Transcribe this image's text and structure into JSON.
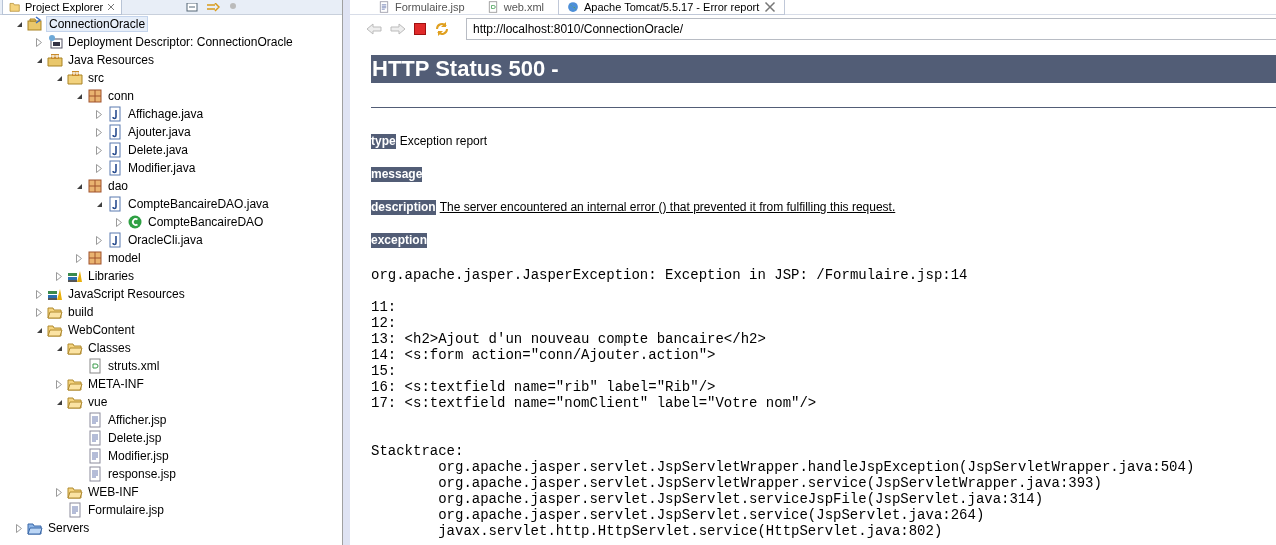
{
  "project_explorer": {
    "title": "Project Explorer",
    "tree": [
      {
        "label": "ConnectionOracle",
        "kind": "project",
        "expanded": true,
        "selected": true,
        "children": [
          {
            "label": "Deployment Descriptor: ConnectionOracle",
            "kind": "descriptor",
            "expanded": false,
            "selected": false
          },
          {
            "label": "Java Resources",
            "kind": "java-resources",
            "expanded": true,
            "selected": false,
            "children": [
              {
                "label": "src",
                "kind": "source-folder",
                "expanded": true,
                "selected": false,
                "children": [
                  {
                    "label": "conn",
                    "kind": "package",
                    "expanded": true,
                    "selected": false,
                    "children": [
                      {
                        "label": "Affichage.java",
                        "kind": "java-file",
                        "expanded": false,
                        "selected": false
                      },
                      {
                        "label": "Ajouter.java",
                        "kind": "java-file",
                        "expanded": false,
                        "selected": false
                      },
                      {
                        "label": "Delete.java",
                        "kind": "java-file",
                        "expanded": false,
                        "selected": false
                      },
                      {
                        "label": "Modifier.java",
                        "kind": "java-file",
                        "expanded": false,
                        "selected": false
                      }
                    ]
                  },
                  {
                    "label": "dao",
                    "kind": "package",
                    "expanded": true,
                    "selected": false,
                    "children": [
                      {
                        "label": "CompteBancaireDAO.java",
                        "kind": "java-file",
                        "expanded": true,
                        "selected": false,
                        "children": [
                          {
                            "label": "CompteBancaireDAO",
                            "kind": "class",
                            "expanded": false,
                            "selected": false
                          }
                        ]
                      },
                      {
                        "label": "OracleCli.java",
                        "kind": "java-file",
                        "expanded": false,
                        "selected": false
                      }
                    ]
                  },
                  {
                    "label": "model",
                    "kind": "package",
                    "expanded": false,
                    "selected": false
                  }
                ]
              },
              {
                "label": "Libraries",
                "kind": "library",
                "expanded": false,
                "selected": false
              }
            ]
          },
          {
            "label": "JavaScript Resources",
            "kind": "library",
            "expanded": false,
            "selected": false
          },
          {
            "label": "build",
            "kind": "folder",
            "expanded": false,
            "selected": false
          },
          {
            "label": "WebContent",
            "kind": "folder",
            "expanded": true,
            "selected": false,
            "children": [
              {
                "label": "Classes",
                "kind": "folder",
                "expanded": true,
                "selected": false,
                "children": [
                  {
                    "label": "struts.xml",
                    "kind": "xml-file",
                    "selected": false
                  }
                ]
              },
              {
                "label": "META-INF",
                "kind": "folder",
                "expanded": false,
                "selected": false
              },
              {
                "label": "vue",
                "kind": "folder",
                "expanded": true,
                "selected": false,
                "children": [
                  {
                    "label": "Afficher.jsp",
                    "kind": "jsp-file",
                    "selected": false
                  },
                  {
                    "label": "Delete.jsp",
                    "kind": "jsp-file",
                    "selected": false
                  },
                  {
                    "label": "Modifier.jsp",
                    "kind": "jsp-file",
                    "selected": false
                  },
                  {
                    "label": "response.jsp",
                    "kind": "jsp-file",
                    "selected": false
                  }
                ]
              },
              {
                "label": "WEB-INF",
                "kind": "folder",
                "expanded": false,
                "selected": false
              },
              {
                "label": "Formulaire.jsp",
                "kind": "jsp-file",
                "selected": false
              }
            ]
          }
        ]
      },
      {
        "label": "Servers",
        "kind": "servers-folder",
        "expanded": false,
        "selected": false
      }
    ]
  },
  "editor_tabs": [
    {
      "label": "Formulaire.jsp",
      "kind": "jsp-file",
      "selected": false
    },
    {
      "label": "web.xml",
      "kind": "xml-file",
      "selected": false
    },
    {
      "label": "Apache Tomcat/5.5.17 - Error report",
      "kind": "browser",
      "selected": true
    }
  ],
  "browser": {
    "url": "http://localhost:8010/ConnectionOracle/",
    "heading": "HTTP Status 500 -",
    "fields": [
      {
        "label": "type",
        "text": "Exception report",
        "underlined": false
      },
      {
        "label": "message"
      },
      {
        "label": "description",
        "text": "The server encountered an internal error () that prevented it from fulfilling this request.",
        "underlined": true
      },
      {
        "label": "exception"
      }
    ],
    "exception_line": "org.apache.jasper.JasperException: Exception in JSP: /Formulaire.jsp:14",
    "source_lines": [
      "11:",
      "12:",
      "13: <h2>Ajout d'un nouveau compte bancaire</h2>",
      "14: <s:form action=\"conn/Ajouter.action\">",
      "15:",
      "16: <s:textfield name=\"rib\" label=\"Rib\"/>",
      "17: <s:textfield name=\"nomClient\" label=\"Votre nom\"/>"
    ],
    "stacktrace_title": "Stacktrace:",
    "stacktrace": [
      "org.apache.jasper.servlet.JspServletWrapper.handleJspException(JspServletWrapper.java:504)",
      "org.apache.jasper.servlet.JspServletWrapper.service(JspServletWrapper.java:393)",
      "org.apache.jasper.servlet.JspServlet.serviceJspFile(JspServlet.java:314)",
      "org.apache.jasper.servlet.JspServlet.service(JspServlet.java:264)",
      "javax.servlet.http.HttpServlet.service(HttpServlet.java:802)"
    ]
  }
}
